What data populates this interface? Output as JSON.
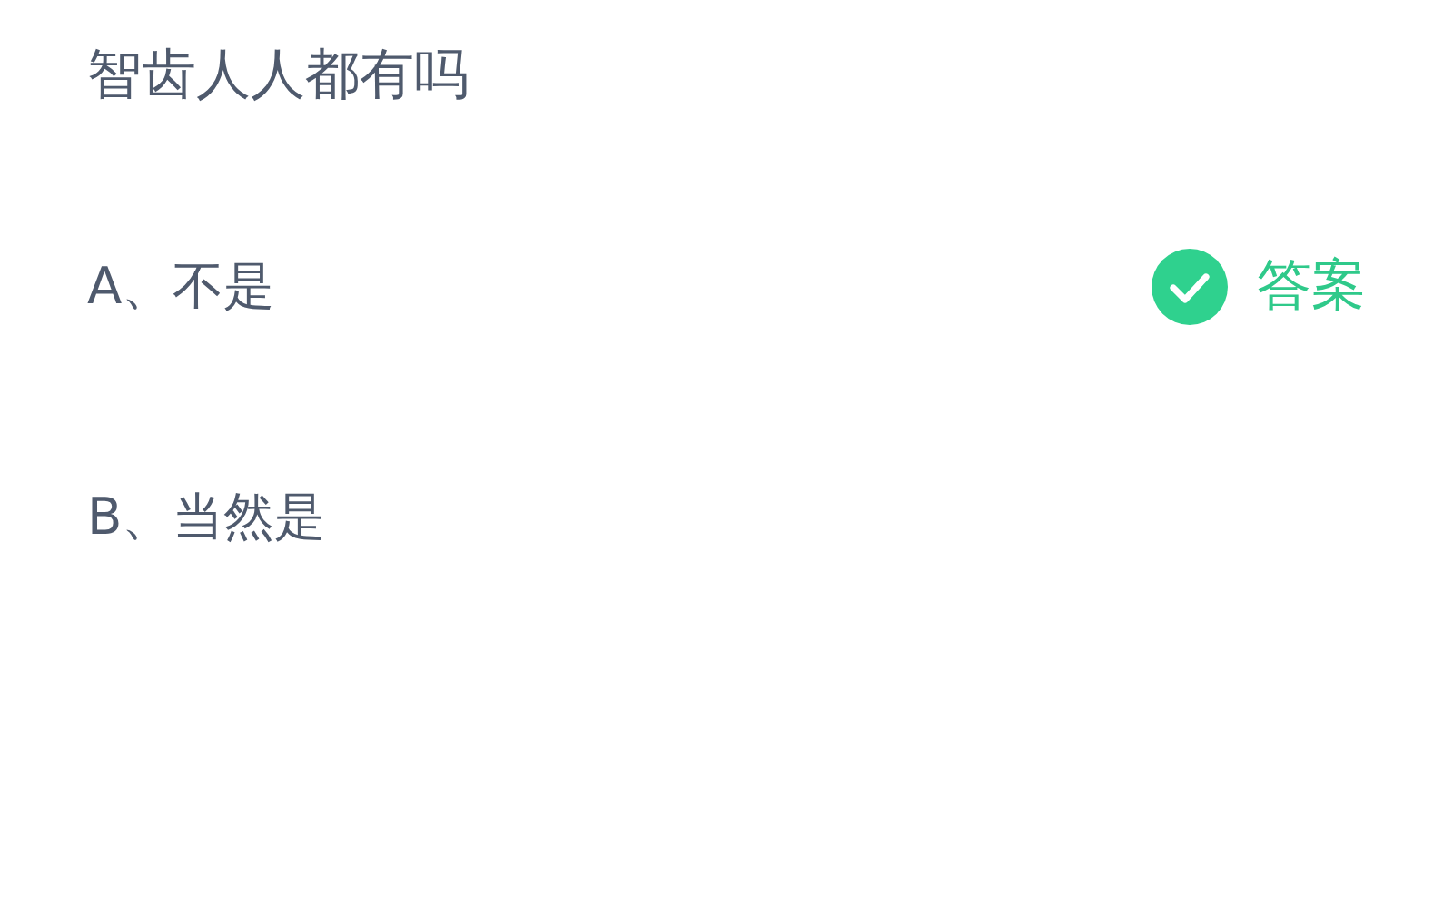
{
  "question": "智齿人人都有吗",
  "options": [
    {
      "text": "A、不是",
      "correct": true
    },
    {
      "text": "B、当然是",
      "correct": false
    }
  ],
  "answer_label": "答案"
}
